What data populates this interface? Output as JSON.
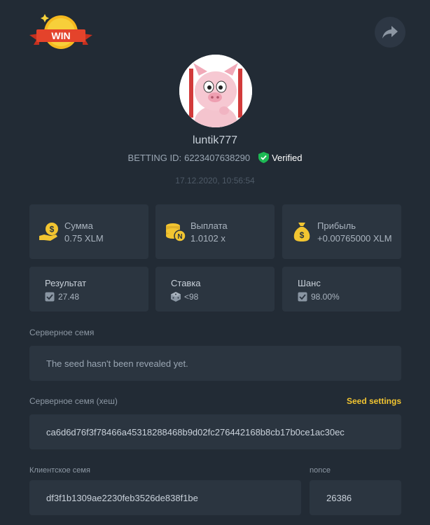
{
  "header": {
    "badge_text": "WIN",
    "share_icon": "share-arrow-icon"
  },
  "profile": {
    "username": "luntik777",
    "betting_id_label": "BETTING ID:",
    "betting_id": "6223407638290",
    "verified_label": "Verified",
    "timestamp": "17.12.2020, 10:56:54"
  },
  "stats": [
    {
      "icon": "money-hand-icon",
      "label": "Сумма",
      "value": "0.75 XLM"
    },
    {
      "icon": "coins-stack-icon",
      "label": "Выплата",
      "value": "1.0102 x"
    },
    {
      "icon": "money-bag-icon",
      "label": "Прибыль",
      "value": "+0.00765000 XLM"
    }
  ],
  "details": [
    {
      "icon": "check-box-icon",
      "label": "Результат",
      "value": "27.48"
    },
    {
      "icon": "dice-icon",
      "label": "Ставка",
      "value": "<98"
    },
    {
      "icon": "check-box-icon",
      "label": "Шанс",
      "value": "98.00%"
    }
  ],
  "server_seed": {
    "label": "Серверное семя",
    "value": "The seed hasn't been revealed yet."
  },
  "server_seed_hash": {
    "label": "Серверное семя (хеш)",
    "settings_link": "Seed settings",
    "value": "ca6d6d76f3f78466a45318288468b9d02fc276442168b8cb17b0ce1ac30ec"
  },
  "client_seed": {
    "label": "Клиентское семя",
    "value": "df3f1b1309ae2230feb3526de838f1be"
  },
  "nonce": {
    "label": "nonce",
    "value": "26386"
  },
  "colors": {
    "background": "#222b35",
    "card": "#2b3540",
    "accent_yellow": "#f2c531",
    "verified_green": "#1db954",
    "badge_red": "#e4432b"
  }
}
